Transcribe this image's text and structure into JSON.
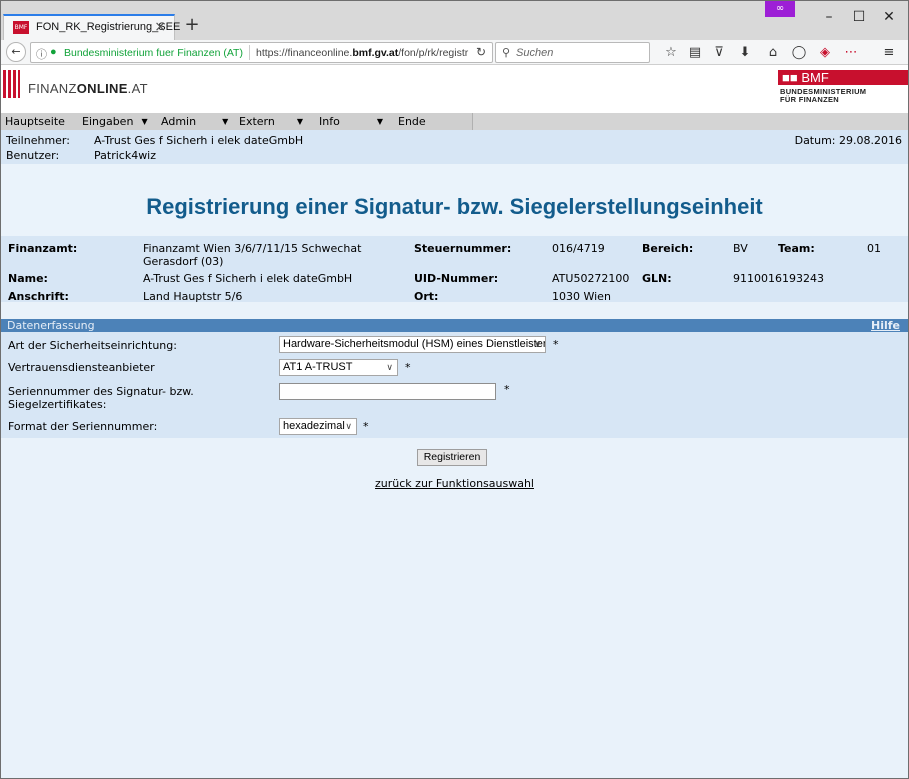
{
  "browser": {
    "tab_title": "FON_RK_Registrierung_SEE",
    "tab_close": "×",
    "new_tab": "+",
    "private_badge": "∞",
    "win_min": "–",
    "win_max": "☐",
    "win_close": "✕",
    "back": "←",
    "info_icon": "ⓘ",
    "lock_icon": "🔒",
    "site_identity": "Bundesministerium fuer Finanzen (AT)",
    "url_prefix": "https://financeonline.",
    "url_host": "bmf.gv.at",
    "url_path": "/fon/p/rk/registr",
    "reload": "↻",
    "search_icon": "⚲",
    "search_placeholder": "Suchen",
    "toolbar_icons": [
      "☆",
      "▤",
      "⊽",
      "⬇",
      "⌂",
      "◯",
      "◈",
      "⋯",
      "≡"
    ]
  },
  "header": {
    "logo_prefix": "FINANZ",
    "logo_bold": "ONLINE",
    "logo_suffix": ".AT",
    "bmf_title": "BMF",
    "bmf_line1": "BUNDESMINISTERIUM",
    "bmf_line2": "FÜR FINANZEN"
  },
  "menu": {
    "items": [
      "Hauptseite",
      "Eingaben",
      "Admin",
      "Extern",
      "Info",
      "Ende"
    ],
    "arrow": "▼"
  },
  "info": {
    "teilnehmer_label": "Teilnehmer:",
    "teilnehmer_value": "A-Trust Ges f Sicherh i elek dateGmbH",
    "benutzer_label": "Benutzer:",
    "benutzer_value": "Patrick4wiz",
    "datum": "Datum: 29.08.2016"
  },
  "title": "Registrierung einer Signatur- bzw. Siegelerstellungseinheit",
  "details": {
    "finanzamt_label": "Finanzamt:",
    "finanzamt_value_1": "Finanzamt Wien 3/6/7/11/15 Schwechat",
    "finanzamt_value_2": "Gerasdorf (03)",
    "steuernummer_label": "Steuernummer:",
    "steuernummer_value": "016/4719",
    "bereich_label": "Bereich:",
    "bereich_value": "BV",
    "team_label": "Team:",
    "team_value": "01",
    "name_label": "Name:",
    "name_value": "A-Trust Ges f Sicherh i elek dateGmbH",
    "uid_label": "UID-Nummer:",
    "uid_value": "ATU50272100",
    "gln_label": "GLN:",
    "gln_value": "9110016193243",
    "anschrift_label": "Anschrift:",
    "anschrift_value": "Land Hauptstr 5/6",
    "ort_label": "Ort:",
    "ort_value": "1030 Wien"
  },
  "section": {
    "title": "Datenerfassung",
    "help": "Hilfe"
  },
  "form": {
    "art_label": "Art der Sicherheitseinrichtung:",
    "art_value": "Hardware-Sicherheitsmodul (HSM) eines Dienstleisters",
    "vda_label": "Vertrauensdiensteanbieter",
    "vda_value": "AT1 A-TRUST",
    "serial_label_1": "Seriennummer des Signatur- bzw.",
    "serial_label_2": "Siegelzertifikates:",
    "serial_value": "",
    "format_label": "Format der Seriennummer:",
    "format_value": "hexadezimal",
    "required_mark": "*",
    "chevron": "∨"
  },
  "actions": {
    "register": "Registrieren",
    "back_link": "zurück zur Funktionsauswahl"
  }
}
